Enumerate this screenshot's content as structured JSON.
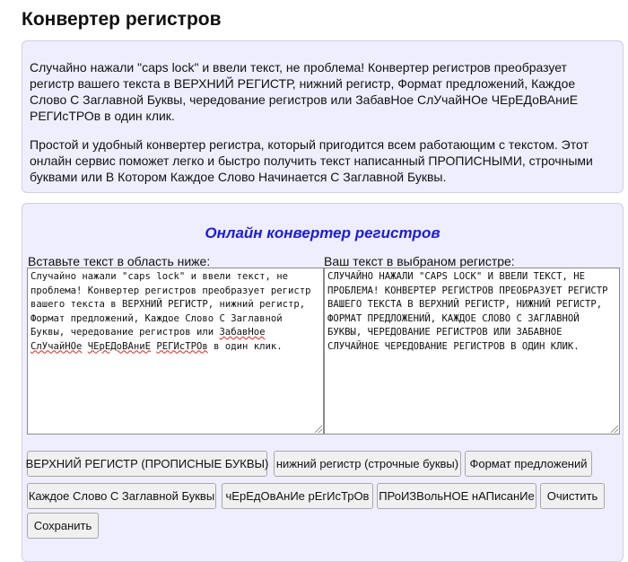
{
  "page": {
    "title": "Конвертер регистров"
  },
  "intro": {
    "paragraph1": "Случайно нажали \"caps lock\" и ввели текст, не проблема! Конвертер регистров преобразует регистр вашего текста в ВЕРХНИЙ РЕГИСТР, нижний регистр, Формат предложений, Каждое Слово С Заглавной Буквы, чередование регистров или ЗабавНое СлУчайНОе ЧЕрЕДоВАниЕ РЕГИсТРОв в один клик.",
    "paragraph2": "Простой и удобный конвертер регистра, который пригодится всем работающим с текстом. Этот онлайн сервис поможет легко и быстро получить текст написанный ПРОПИСНЫМИ, строчными буквами или В Котором Каждое Слово Начинается С Заглавной Буквы."
  },
  "tool": {
    "heading": "Онлайн конвертер регистров",
    "input_label": "Вставьте текст в область ниже:",
    "output_label": "Ваш текст в выбраном регистре:",
    "input_text_main": "Случайно нажали \"caps lock\" и ввели текст, не проблема! Конвертер регистров преобразует регистр вашего текста в ВЕРХНИЙ РЕГИСТР, нижний регистр, Формат предложений, Каждое Слово С Заглавной Буквы, чередование регистров или ",
    "input_text_w1": "ЗабавНое",
    "input_text_w2": "СлУчайНОе",
    "input_text_w3": "ЧЕрЕДоВАниЕ",
    "input_text_w4": "РЕГИсТРОв",
    "input_text_end": " в один клик.",
    "output_text": "СЛУЧАЙНО НАЖАЛИ \"CAPS LOCK\" И ВВЕЛИ ТЕКСТ, НЕ ПРОБЛЕМА! КОНВЕРТЕР РЕГИСТРОВ ПРЕОБРАЗУЕТ РЕГИСТР ВАШЕГО ТЕКСТА В ВЕРХНИЙ РЕГИСТР, НИЖНИЙ РЕГИСТР, ФОРМАТ ПРЕДЛОЖЕНИЙ, КАЖДОЕ СЛОВО С ЗАГЛАВНОЙ БУКВЫ, ЧЕРЕДОВАНИЕ РЕГИСТРОВ ИЛИ ЗАБАВНОЕ СЛУЧАЙНОЕ ЧЕРЕДОВАНИЕ РЕГИСТРОВ В ОДИН КЛИК."
  },
  "buttons": {
    "upper": "ВЕРХНИЙ РЕГИСТР (ПРОПИСНЫЕ БУКВЫ)",
    "lower": "нижний регистр (строчные буквы)",
    "sentence": "Формат предложений",
    "title_case": "Каждое Слово С Заглавной Буквы",
    "alternating": "чЕрЕдОвАнИе рЕгИсТрОв",
    "random": "ПРоИЗВольНОЕ нАПисанИе",
    "clear": "Очистить",
    "save": "Сохранить"
  },
  "colors": {
    "panel_bg": "#eeeeff",
    "heading_blue": "#1a1ae6"
  }
}
